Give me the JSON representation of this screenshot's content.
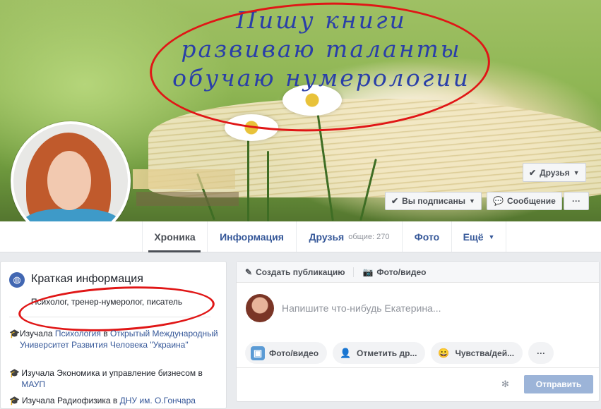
{
  "cover": {
    "text_lines": [
      "Пишу книги",
      "развиваю таланты",
      "обучаю нумерологии"
    ],
    "friends_button": "Друзья",
    "subscribed_button": "Вы подписаны",
    "message_button": "Сообщение",
    "more_button": "···"
  },
  "nav": {
    "tabs": [
      {
        "label": "Хроника"
      },
      {
        "label": "Информация"
      },
      {
        "label": "Друзья",
        "sub": "общие: 270"
      },
      {
        "label": "Фото"
      },
      {
        "label": "Ещё"
      }
    ]
  },
  "intro": {
    "title": "Краткая информация",
    "bio": "Психолог, тренер-нумеролог, писатель",
    "education": [
      {
        "prefix": "Изучала ",
        "subject": "Психология",
        "mid": " в ",
        "link": "Открытый Международный Университет Развития Человека \"Украина\""
      },
      {
        "prefix": "Изучала ",
        "subject": "Экономика и управление бизнесом",
        "mid": " в ",
        "link": "МАУП"
      },
      {
        "prefix": "Изучала ",
        "subject": "Радиофизика",
        "mid": " в ",
        "link": "ДНУ им. О.Гончара"
      }
    ]
  },
  "composer": {
    "create_post": "Создать публикацию",
    "photo_video_tab": "Фото/видео",
    "placeholder": "Напишите что-нибудь Екатерина...",
    "chips": {
      "photo": "Фото/видео",
      "tag": "Отметить др...",
      "feeling": "Чувства/дей...",
      "more": "···"
    },
    "send": "Отправить"
  },
  "colors": {
    "accent": "#365899",
    "annotation_red": "#e01616",
    "cover_text": "#2a3fa8"
  }
}
